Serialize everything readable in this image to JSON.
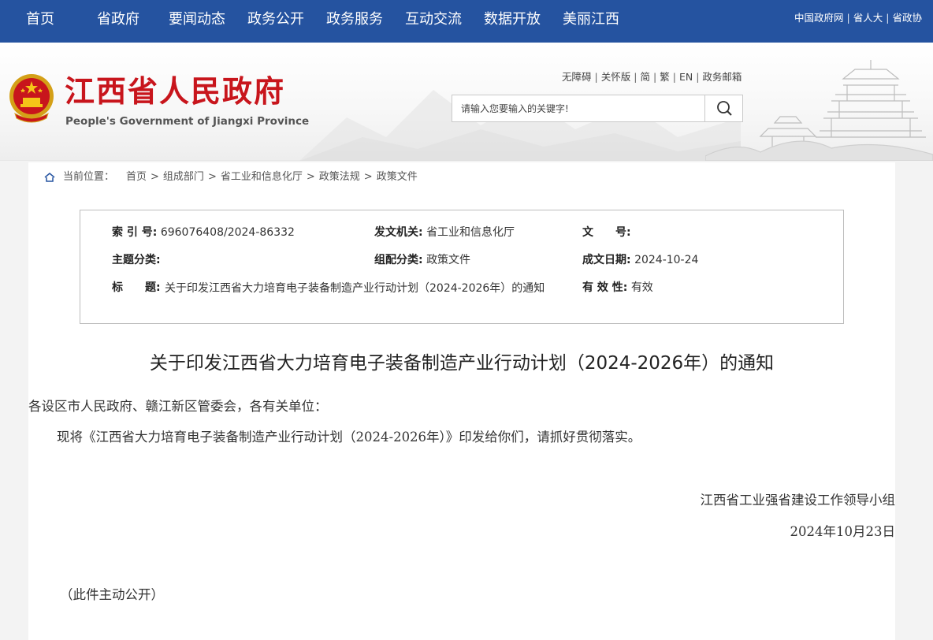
{
  "nav": {
    "items": [
      "首页",
      "省政府",
      "要闻动态",
      "政务公开",
      "政务服务",
      "互动交流",
      "数据开放",
      "美丽江西"
    ],
    "external_links": [
      "中国政府网",
      "省人大",
      "省政协"
    ],
    "bg_color": "#2553a0"
  },
  "header": {
    "title": "江西省人民政府",
    "subtitle": "People's Government of Jiangxi Province",
    "util_links": [
      "无障碍",
      "关怀版",
      "简",
      "繁",
      "EN",
      "政务邮箱"
    ],
    "search_placeholder": "请输入您要输入的关键字!",
    "title_color": "#c8151c"
  },
  "breadcrumb": {
    "label": "当前位置：",
    "path": [
      "首页",
      "组成部门",
      "省工业和信息化厅",
      "政策法规",
      "政策文件"
    ]
  },
  "info": {
    "index_no_label": "索 引 号:",
    "index_no": "696076408/2024-86332",
    "issuer_label": "发文机关:",
    "issuer": "省工业和信息化厅",
    "doc_no_label": "文　　号:",
    "doc_no": "",
    "subject_label": "主题分类:",
    "subject": "",
    "category_label": "组配分类:",
    "category": "政策文件",
    "date_label": "成文日期:",
    "date": "2024-10-24",
    "title_label": "标　　题:",
    "title": "关于印发江西省大力培育电子装备制造产业行动计划（2024-2026年）的通知",
    "validity_label": "有 效 性:",
    "validity": "有效"
  },
  "document": {
    "title": "关于印发江西省大力培育电子装备制造产业行动计划（2024-2026年）的通知",
    "salutation": "各设区市人民政府、赣江新区管委会，各有关单位：",
    "body": "现将《江西省大力培育电子装备制造产业行动计划（2024-2026年）》印发给你们，请抓好贯彻落实。",
    "signature": "江西省工业强省建设工作领导小组",
    "date": "2024年10月23日",
    "note": "（此件主动公开）"
  }
}
